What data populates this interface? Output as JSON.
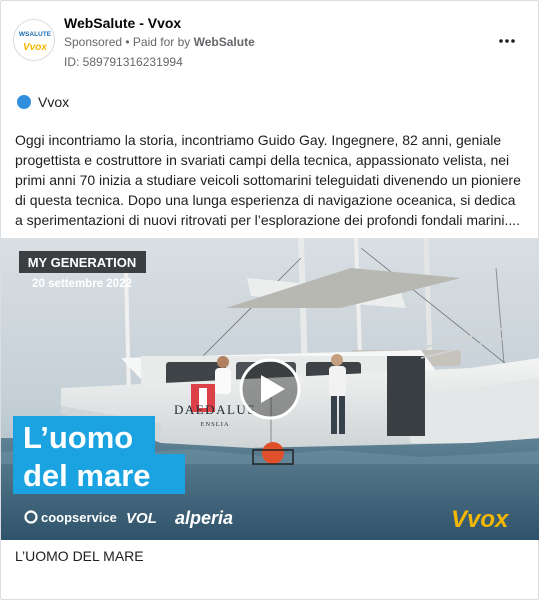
{
  "header": {
    "page_name": "WebSalute - Vvox",
    "sponsored": "Sponsored",
    "separator": " • ",
    "paid_for": "Paid for by",
    "paid_by": "WebSalute",
    "ad_id": "ID: 589791316231994",
    "more_icon": "more-horizontal-icon",
    "avatar_logo_top": "WSALUTE",
    "avatar_logo_bottom": "Vvox"
  },
  "platform": {
    "icon": "platform-dot-icon",
    "name": "Vvox",
    "color": "#2f8fdc"
  },
  "body": {
    "text": "Oggi incontriamo la storia, incontriamo Guido Gay. Ingegnere, 82 anni, geniale progettista e costruttore in svariati campi della tecnica, appassionato velista, nei primi anni 70 inizia a studiare veicoli sottomarini teleguidati divenendo un pioniere di questa tecnica. Dopo una lunga esperienza di navigazione oceanica, si dedica a sperimentazioni di nuovi ritrovati per l’esplorazione dei profondi fondali marini...."
  },
  "media": {
    "banner_title": "MY GENERATION",
    "banner_date": "20 settembre 2022",
    "headline_line1": "L’uomo",
    "headline_line2": "del mare",
    "boat_name": "DAEDALUS",
    "boat_port": "ENSLIA",
    "sponsors": [
      "coopservice",
      "VOL",
      "alperia"
    ],
    "brand": "Vvox",
    "play_icon": "play-icon",
    "accent_color": "#1aa3e0",
    "brand_colors": [
      "#f5b800",
      "#1aa3e0"
    ]
  },
  "caption": {
    "text": "L’UOMO DEL MARE"
  }
}
